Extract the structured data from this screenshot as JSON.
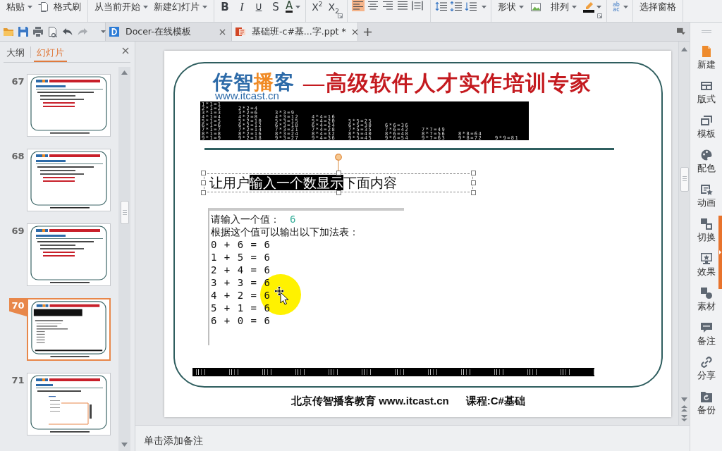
{
  "ribbon": {
    "paste": "粘贴",
    "format_painter": "格式刷",
    "play_from_current": "从当前开始",
    "new_slide": "新建幻灯片",
    "font_styles": [
      "B",
      "I",
      "U",
      "S"
    ],
    "font_color": "A",
    "superscript": "X$^{2}$",
    "subscript": "X$_{2}$",
    "alignment": [
      {
        "selected": true
      },
      {
        "selected": false
      },
      {
        "selected": false
      },
      {
        "selected": false
      },
      {
        "selected": false
      }
    ],
    "shape": "形状",
    "arrange": "排列",
    "case_button": [
      "ab",
      "ac"
    ],
    "selection_pane": "选择窗格"
  },
  "quick_access": [
    {
      "disabled": false
    },
    {
      "disabled": false
    },
    {
      "disabled": false
    },
    {
      "disabled": false
    },
    {
      "disabled": false
    },
    {
      "disabled": true
    }
  ],
  "tabs": [
    {
      "kind": "web",
      "title": "Docer-在线模板",
      "selected": false
    },
    {
      "kind": "document",
      "title": "基础班-c#基...字.ppt *",
      "selected": true
    }
  ],
  "side_panel": {
    "tabs": [
      {
        "label": "大纲",
        "selected": false
      },
      {
        "label": "幻灯片",
        "selected": true
      }
    ],
    "slides": [
      {
        "number": "67",
        "kind": "bullets",
        "selected": false
      },
      {
        "number": "68",
        "kind": "bullets",
        "selected": false
      },
      {
        "number": "69",
        "kind": "bullets",
        "selected": false
      },
      {
        "number": "70",
        "kind": "console",
        "selected": true
      },
      {
        "number": "71",
        "kind": "diagram",
        "selected": false
      }
    ]
  },
  "slide": {
    "logo": {
      "runs": [
        {
          "text": "传智",
          "accent": false
        },
        {
          "text": "播",
          "accent": true
        },
        {
          "text": "客",
          "accent": false
        }
      ],
      "url": "www.itcast.cn"
    },
    "tagline": "—高级软件人才实作培训专家",
    "multiplication_table": [
      [
        "1*1=1"
      ],
      [
        "2*1=2",
        "2*2=4"
      ],
      [
        "3*1=3",
        "3*2=6",
        "3*3=9"
      ],
      [
        "4*1=4",
        "4*2=8",
        "4*3=12",
        "4*4=16"
      ],
      [
        "5*1=5",
        "5*2=10",
        "5*3=15",
        "5*4=20",
        "5*5=25"
      ],
      [
        "6*1=6",
        "6*2=12",
        "6*3=18",
        "6*4=24",
        "6*5=30",
        "6*6=36"
      ],
      [
        "7*1=7",
        "7*2=14",
        "7*3=21",
        "7*4=28",
        "7*5=35",
        "7*6=42",
        "7*7=49"
      ],
      [
        "8*1=8",
        "8*2=16",
        "8*3=24",
        "8*4=32",
        "8*5=40",
        "8*6=48",
        "8*7=56",
        "8*8=64"
      ],
      [
        "9*1=9",
        "9*2=18",
        "9*3=27",
        "9*4=36",
        "9*5=45",
        "9*6=54",
        "9*7=63",
        "9*8=72",
        "9*9=81"
      ]
    ],
    "text_box": {
      "runs": [
        {
          "text": "让用户",
          "selected": false
        },
        {
          "text": "输入一个数显示",
          "selected": true
        },
        {
          "text": "下面内容",
          "selected": false
        }
      ]
    },
    "console": {
      "prompt": "请输入一个值：",
      "input": "6",
      "heading": "根据这个值可以输出以下加法表：",
      "lines": [
        "0 + 6 = 6",
        "1 + 5 = 6",
        "2 + 4 = 6",
        "3 + 3 = 6",
        "4 + 2 = 6",
        "5 + 1 = 6",
        "6 + 0 = 6"
      ]
    },
    "footer": [
      "北京传智播客教育 www.itcast.cn",
      "课程:C#基础"
    ]
  },
  "notes": {
    "placeholder": "单击添加备注"
  },
  "right_sidebar": {
    "items": [
      "新建",
      "版式",
      "模板",
      "配色",
      "动画",
      "切换",
      "效果",
      "素材",
      "备注",
      "分享",
      "备份"
    ]
  }
}
